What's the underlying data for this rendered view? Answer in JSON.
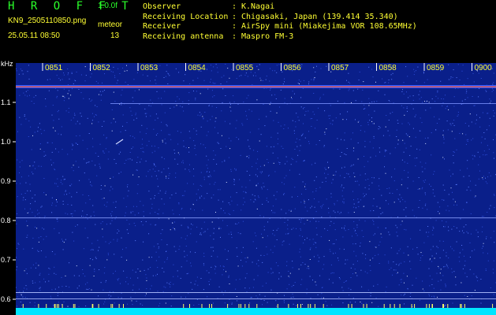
{
  "header": {
    "app_title": "H R O F F T",
    "version": "1.0.0f",
    "filename": "KN9_2505110850.png",
    "meteor_label": "meteor",
    "datetime": "25.05.11 08:50",
    "count": "13",
    "info": [
      {
        "label": "Observer",
        "sep": ":",
        "value": "K.Nagai"
      },
      {
        "label": "Receiving Location",
        "sep": ":",
        "value": "Chigasaki, Japan (139.414 35.340)"
      },
      {
        "label": "Receiver",
        "sep": ":",
        "value": "AirSpy mini (Miakejima VOR 108.65MHz)"
      },
      {
        "label": "Receiving antenna",
        "sep": ":",
        "value": "Maspro FM-3"
      }
    ]
  },
  "axis": {
    "unit": "kHz",
    "y_ticks": [
      "1.1",
      "1.0",
      "0.9",
      "0.8",
      "0.7",
      "0.6"
    ],
    "time_ticks": [
      "0851",
      "0852",
      "0853",
      "0854",
      "0855",
      "0856",
      "0857",
      "0858",
      "0859",
      "0900"
    ]
  },
  "colors": {
    "background": "#0a1f8a",
    "noise": "#5a7cff",
    "carrier": "#ff5a3a",
    "header_green": "#2aff2a",
    "header_yellow": "#ffff33",
    "baseline": "#00e5ff"
  }
}
